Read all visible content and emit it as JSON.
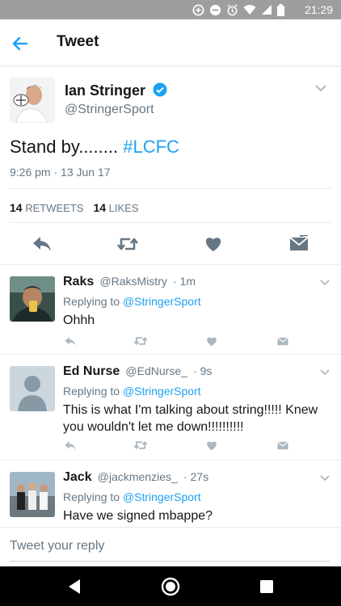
{
  "status_bar": {
    "time": "21:29",
    "icons": [
      "data-saver-icon",
      "do-not-disturb-icon",
      "alarm-icon",
      "wifi-icon",
      "signal-icon",
      "battery-icon"
    ]
  },
  "app_bar": {
    "title": "Tweet",
    "back_icon": "arrow-left-icon"
  },
  "tweet": {
    "author_name": "Ian Stringer",
    "handle": "@StringerSport",
    "verified": true,
    "text": "Stand by........",
    "hashtag": "#LCFC",
    "timestamp": "9:26 pm · 13 Jun 17",
    "retweets_count": "14",
    "retweets_label": "RETWEETS",
    "likes_count": "14",
    "likes_label": "LIKES",
    "actions": [
      "reply-icon",
      "retweet-icon",
      "heart-icon",
      "direct-message-icon"
    ]
  },
  "replies": [
    {
      "name": "Raks",
      "handle": "@RaksMistry",
      "time": "· 1m",
      "replying_prefix": "Replying to",
      "replying_to": "@StringerSport",
      "text": "Ohhh"
    },
    {
      "name": "Ed Nurse",
      "handle": "@EdNurse_",
      "time": "· 9s",
      "replying_prefix": "Replying to",
      "replying_to": "@StringerSport",
      "text": "This is what I'm talking about string!!!!! Knew you wouldn't let me down!!!!!!!!!!"
    },
    {
      "name": "Jack",
      "handle": "@jackmenzies_",
      "time": "· 27s",
      "replying_prefix": "Replying to",
      "replying_to": "@StringerSport",
      "text": "Have we signed mbappe?"
    }
  ],
  "compose": {
    "placeholder": "Tweet your reply"
  },
  "colors": {
    "accent": "#1da1f2",
    "text": "#14171a",
    "secondary_text": "#657786",
    "icon": "#657786",
    "icon_light": "#aab8c2",
    "divider": "#e6ecf0",
    "status_bar": "#9e9e9e",
    "nav_bar": "#000000"
  }
}
